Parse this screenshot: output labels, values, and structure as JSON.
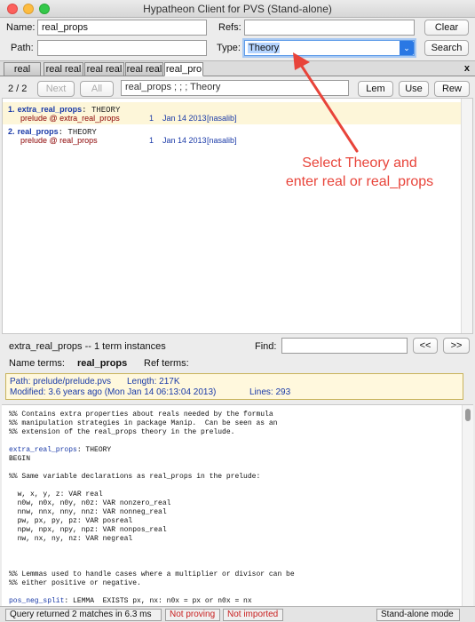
{
  "window": {
    "title": "Hypatheon Client for PVS (Stand-alone)"
  },
  "search": {
    "name_label": "Name:",
    "name_value": "real_props",
    "refs_label": "Refs:",
    "refs_value": "",
    "path_label": "Path:",
    "path_value": "",
    "type_label": "Type:",
    "type_value": "Theory",
    "clear_label": "Clear",
    "search_label": "Search"
  },
  "tabs": [
    "real",
    "real real",
    "real real",
    "real real",
    "real_pro"
  ],
  "tab_close": "x",
  "results_toolbar": {
    "count": "2 / 2",
    "next_label": "Next",
    "all_label": "All",
    "query_text": "real_props  ;    ;    ;  Theory",
    "lem_label": "Lem",
    "use_label": "Use",
    "rew_label": "Rew"
  },
  "results": [
    {
      "index": "1.",
      "name": "extra_real_props",
      "kind": "THEORY",
      "location": "prelude @ extra_real_props",
      "count": "1",
      "date": "Jan 14 2013",
      "user": "[nasalib]"
    },
    {
      "index": "2.",
      "name": "real_props",
      "kind": "THEORY",
      "location": "prelude @ real_props",
      "count": "1",
      "date": "Jan 14 2013",
      "user": "[nasalib]"
    }
  ],
  "annotation": {
    "line1": "Select Theory and",
    "line2": "enter real or real_props"
  },
  "detail": {
    "summary": "extra_real_props -- 1 term instances",
    "find_label": "Find:",
    "find_value": "",
    "prev_label": "<<",
    "next_label": ">>",
    "name_terms_label": "Name terms:",
    "name_terms_value": "real_props",
    "ref_terms_label": "Ref terms:",
    "ref_terms_value": "",
    "path_line": "Path:  prelude/prelude.pvs",
    "length_line": "Length:  217K",
    "modified_line": "Modified:  3.6 years ago  (Mon Jan 14 06:13:04 2013)",
    "lines_line": "Lines:  293"
  },
  "code": {
    "c1": "%% Contains extra properties about reals needed by the formula",
    "c2": "%% manipulation strategies in package Manip.  Can be seen as an",
    "c3": "%% extension of the real_props theory in the prelude.",
    "theory_name": "extra_real_props",
    "theory_kw": ": THEORY",
    "begin": "BEGIN",
    "c4": "%% Same variable declarations as real_props in the prelude:",
    "v1": "  w, x, y, z: VAR real",
    "v2": "  n0w, n0x, n0y, n0z: VAR nonzero_real",
    "v3": "  nnw, nnx, nny, nnz: VAR nonneg_real",
    "v4": "  pw, px, py, pz: VAR posreal",
    "v5": "  npw, npx, npy, npz: VAR nonpos_real",
    "v6": "  nw, nx, ny, nz: VAR negreal",
    "c5": "%% Lemmas used to handle cases where a multiplier or divisor can be",
    "c6": "%% either positive or negative.",
    "lemma_name": "pos_neg_split",
    "lemma_body": ": LEMMA  EXISTS px, nx: n0x = px or n0x = nx"
  },
  "status": {
    "query": "Query returned 2 matches in 6.3 ms",
    "proving": "Not proving",
    "imported": "Not imported",
    "mode": "Stand-alone mode"
  },
  "colors": {
    "annotation": "#e8443a",
    "link": "#1a3aa8",
    "highlight_row": "#fdf6d9"
  }
}
